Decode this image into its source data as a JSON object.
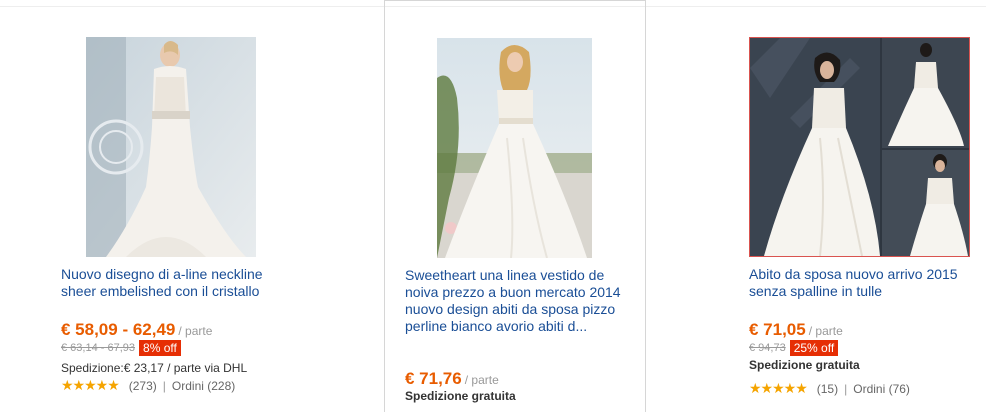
{
  "products": [
    {
      "title": "Nuovo disegno di a-line neckline sheer embelished con il cristallo",
      "price": "€ 58,09 - 62,49",
      "unit": "/ parte",
      "old_price": "€ 63,14 - 67,93",
      "discount": "8% off",
      "shipping": "Spedizione:€ 23,17 / parte via DHL",
      "stars": "★★★★★",
      "reviews": "(273)",
      "orders": "Ordini (228)"
    },
    {
      "title": "Sweetheart una linea vestido de noiva prezzo a buon mercato 2014 nuovo design abiti da sposa pizzo perline bianco avorio abiti d...",
      "price": "€ 71,76",
      "unit": "/ parte",
      "shipping": "Spedizione gratuita"
    },
    {
      "title": "Abito da sposa nuovo arrivo 2015 senza spalline in tulle",
      "price": "€ 71,05",
      "unit": "/ parte",
      "old_price": "€ 94,73",
      "discount": "25% off",
      "shipping": "Spedizione gratuita",
      "stars": "★★★★★",
      "reviews": "(15)",
      "orders": "Ordini (76)"
    }
  ],
  "separator": "|"
}
